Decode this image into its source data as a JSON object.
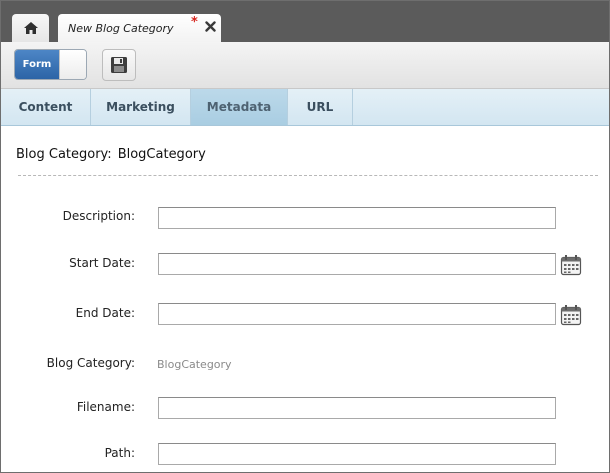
{
  "tabs": {
    "home_icon": "home-icon",
    "document_tab_title": "New Blog Category",
    "unsaved_marker": "*",
    "close_icon": "close-icon"
  },
  "toolbar": {
    "form_toggle_label": "Form",
    "form_toggle_on": true,
    "save_icon": "floppy-disk-icon"
  },
  "section_tabs": [
    {
      "label": "Content",
      "active": false
    },
    {
      "label": "Marketing",
      "active": false
    },
    {
      "label": "Metadata",
      "active": true
    },
    {
      "label": "URL",
      "active": false
    }
  ],
  "page": {
    "heading_label": "Blog Category:",
    "heading_value": "BlogCategory"
  },
  "fields": {
    "description": {
      "label": "Description:",
      "value": ""
    },
    "start_date": {
      "label": "Start Date:",
      "value": "",
      "icon": "calendar-icon"
    },
    "end_date": {
      "label": "End Date:",
      "value": "",
      "icon": "calendar-icon"
    },
    "blog_category": {
      "label": "Blog Category:",
      "value": "BlogCategory"
    },
    "filename": {
      "label": "Filename:",
      "value": ""
    },
    "path": {
      "label": "Path:",
      "value": ""
    }
  },
  "colors": {
    "tab_bar": "#5b5b5b",
    "accent_blue": "#2c64a6",
    "section_tab_bg": "#d3e6f1",
    "active_section_tab": "#a9cde2",
    "dirty_marker": "#d6261f"
  }
}
